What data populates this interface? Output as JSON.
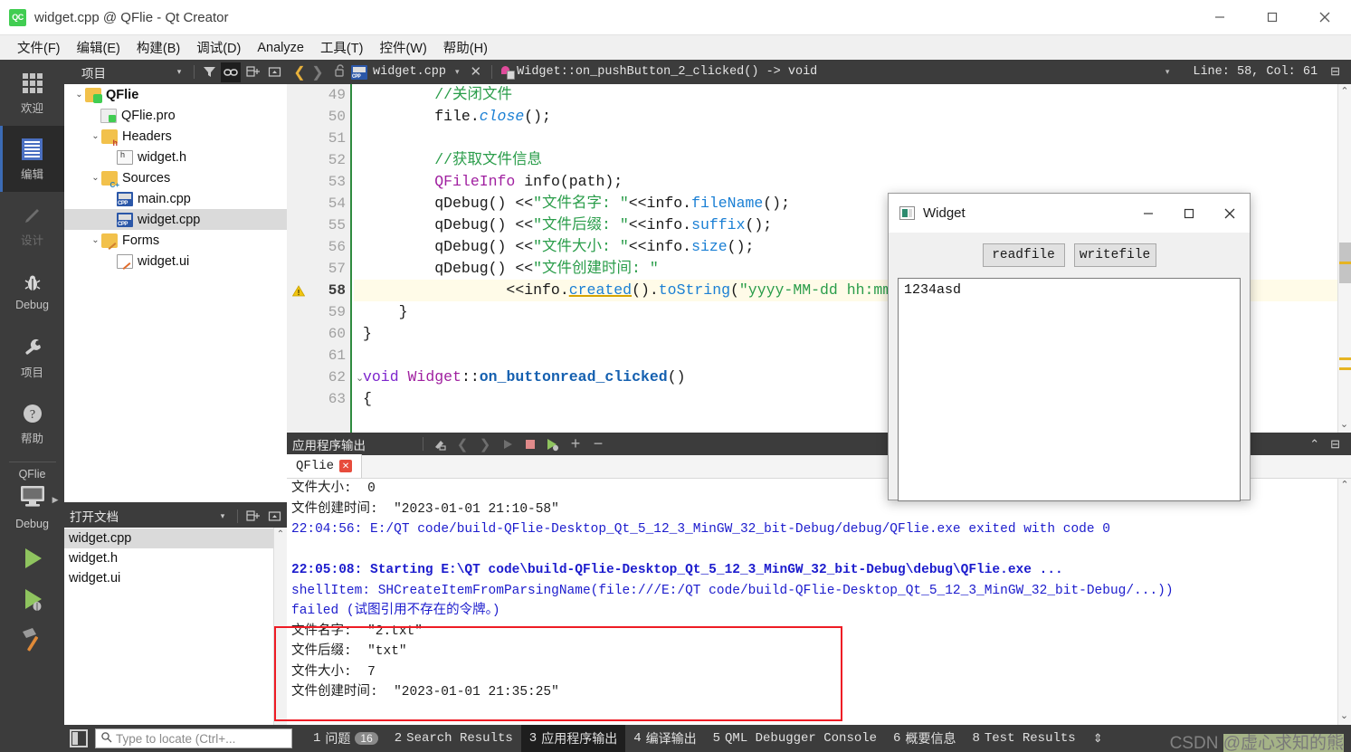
{
  "window": {
    "title": "widget.cpp @ QFlie - Qt Creator",
    "logo_text": "QC",
    "minimize": "—",
    "maximize": "□",
    "close": "✕"
  },
  "menubar": {
    "items": [
      {
        "label": "文件(F)"
      },
      {
        "label": "编辑(E)"
      },
      {
        "label": "构建(B)"
      },
      {
        "label": "调试(D)"
      },
      {
        "label": "Analyze"
      },
      {
        "label": "工具(T)"
      },
      {
        "label": "控件(W)"
      },
      {
        "label": "帮助(H)"
      }
    ]
  },
  "modebar": {
    "items": [
      {
        "label": "欢迎",
        "icon": "grid-icon",
        "active": false
      },
      {
        "label": "编辑",
        "icon": "document-lines-icon",
        "active": true
      },
      {
        "label": "设计",
        "icon": "pencil-icon",
        "active": false
      },
      {
        "label": "Debug",
        "icon": "bug-icon",
        "active": false
      },
      {
        "label": "项目",
        "icon": "wrench-icon",
        "active": false
      },
      {
        "label": "帮助",
        "icon": "question-circle-icon",
        "active": false
      }
    ],
    "kit_project": "QFlie",
    "kit_config": "Debug",
    "run_label": "run",
    "debug_label": "debug",
    "build_label": "build"
  },
  "project_panel": {
    "title": "项目",
    "tools": [
      "filter-icon",
      "link-icon",
      "expand-all-icon",
      "collapse-icon"
    ],
    "tree": [
      {
        "label": "QFlie",
        "indent": 0,
        "chevron": "⌄",
        "icon": "qt-project-folder-icon",
        "bold": true,
        "selected": false
      },
      {
        "label": "QFlie.pro",
        "indent": 1,
        "chevron": "",
        "icon": "pro-file-icon",
        "bold": false,
        "selected": false
      },
      {
        "label": "Headers",
        "indent": 1,
        "chevron": "⌄",
        "icon": "headers-folder-icon",
        "bold": false,
        "selected": false
      },
      {
        "label": "widget.h",
        "indent": 2,
        "chevron": "",
        "icon": "header-file-icon",
        "bold": false,
        "selected": false
      },
      {
        "label": "Sources",
        "indent": 1,
        "chevron": "⌄",
        "icon": "sources-folder-icon",
        "bold": false,
        "selected": false
      },
      {
        "label": "main.cpp",
        "indent": 2,
        "chevron": "",
        "icon": "cpp-file-icon",
        "bold": false,
        "selected": false
      },
      {
        "label": "widget.cpp",
        "indent": 2,
        "chevron": "",
        "icon": "cpp-file-icon",
        "bold": false,
        "selected": true
      },
      {
        "label": "Forms",
        "indent": 1,
        "chevron": "⌄",
        "icon": "forms-folder-icon",
        "bold": false,
        "selected": false
      },
      {
        "label": "widget.ui",
        "indent": 2,
        "chevron": "",
        "icon": "ui-file-icon",
        "bold": false,
        "selected": false
      }
    ]
  },
  "open_documents": {
    "title": "打开文档",
    "items": [
      {
        "label": "widget.cpp",
        "selected": true
      },
      {
        "label": "widget.h",
        "selected": false
      },
      {
        "label": "widget.ui",
        "selected": false
      }
    ]
  },
  "editor_toolbar": {
    "back": "❮",
    "forward": "❯",
    "lock": "🔓",
    "file_name": "widget.cpp",
    "caret": "▾",
    "close": "✕",
    "symbol": "Widget::on_pushButton_2_clicked() -> void",
    "symbol_caret": "▾",
    "line_col": "Line: 58, Col: 61",
    "split": "⊟"
  },
  "code": {
    "lines": [
      {
        "num": "49",
        "warn": false,
        "fold": "",
        "current": false,
        "html": "        <span class=\"cmt\">//关闭文件</span>"
      },
      {
        "num": "50",
        "warn": false,
        "fold": "",
        "current": false,
        "html": "        file.<span class=\"ital\">close</span>();"
      },
      {
        "num": "51",
        "warn": false,
        "fold": "",
        "current": false,
        "html": ""
      },
      {
        "num": "52",
        "warn": false,
        "fold": "",
        "current": false,
        "html": "        <span class=\"cmt\">//获取文件信息</span>"
      },
      {
        "num": "53",
        "warn": false,
        "fold": "",
        "current": false,
        "html": "        <span class=\"typ\">QFileInfo</span> info(path);"
      },
      {
        "num": "54",
        "warn": false,
        "fold": "",
        "current": false,
        "html": "        qDebug() &lt;&lt;<span class=\"str\">\"文件名字: \"</span>&lt;&lt;info.<span class=\"fn\">fileName</span>();"
      },
      {
        "num": "55",
        "warn": false,
        "fold": "",
        "current": false,
        "html": "        qDebug() &lt;&lt;<span class=\"str\">\"文件后缀: \"</span>&lt;&lt;info.<span class=\"fn\">suffix</span>();"
      },
      {
        "num": "56",
        "warn": false,
        "fold": "",
        "current": false,
        "html": "        qDebug() &lt;&lt;<span class=\"str\">\"文件大小: \"</span>&lt;&lt;info.<span class=\"fn\">size</span>();"
      },
      {
        "num": "57",
        "warn": false,
        "fold": "",
        "current": false,
        "html": "        qDebug() &lt;&lt;<span class=\"str\">\"文件创建时间: \"</span>"
      },
      {
        "num": "58",
        "warn": true,
        "fold": "",
        "current": true,
        "html": "                &lt;&lt;info.<span class=\"und\">created</span>().<span class=\"fn\">toString</span>(<span class=\"str\">\"yyyy-MM-dd hh:mm:ss\"</span>);"
      },
      {
        "num": "59",
        "warn": false,
        "fold": "",
        "current": false,
        "html": "    }"
      },
      {
        "num": "60",
        "warn": false,
        "fold": "",
        "current": false,
        "html": "}"
      },
      {
        "num": "61",
        "warn": false,
        "fold": "",
        "current": false,
        "html": ""
      },
      {
        "num": "62",
        "warn": false,
        "fold": "⌄",
        "current": false,
        "html": "<span class=\"kw\">void</span> <span class=\"typ\">Widget</span>::<span class=\"fnb\">on_buttonread_clicked</span>()"
      },
      {
        "num": "63",
        "warn": false,
        "fold": "",
        "current": false,
        "html": "{"
      }
    ]
  },
  "output_panel": {
    "title": "应用程序输出",
    "tools": [
      "clear-icon",
      "prev-icon",
      "next-icon",
      "run-icon",
      "stop-icon",
      "rerun-debug-icon",
      "zoom-in-icon",
      "zoom-out-icon"
    ],
    "collapse": "⌃",
    "maximize": "⊟",
    "tab_label": "QFlie",
    "tab_close": "✕",
    "lines": [
      {
        "text": "文件大小:  0",
        "style": "dark"
      },
      {
        "text": "文件创建时间:  \"2023-01-01 21:10-58\"",
        "style": "dark"
      },
      {
        "text": "22:04:56: E:/QT code/build-QFlie-Desktop_Qt_5_12_3_MinGW_32_bit-Debug/debug/QFlie.exe exited with code 0",
        "style": "blue"
      },
      {
        "text": "",
        "style": "dark"
      },
      {
        "text": "22:05:08: Starting E:\\QT code\\build-QFlie-Desktop_Qt_5_12_3_MinGW_32_bit-Debug\\debug\\QFlie.exe ...",
        "style": "blueb"
      },
      {
        "text": "shellItem: SHCreateItemFromParsingName(file:///E:/QT code/build-QFlie-Desktop_Qt_5_12_3_MinGW_32_bit-Debug/...))",
        "style": "blue"
      },
      {
        "text": "failed (试图引用不存在的令牌。)",
        "style": "blue"
      },
      {
        "text": "文件名字:  \"2.txt\"",
        "style": "dark"
      },
      {
        "text": "文件后缀:  \"txt\"",
        "style": "dark"
      },
      {
        "text": "文件大小:  7",
        "style": "dark"
      },
      {
        "text": "文件创建时间:  \"2023-01-01 21:35:25\"",
        "style": "dark"
      }
    ],
    "highlight_color": "#ee1c25"
  },
  "statusbar": {
    "toggle_sidebar": "sidebar-toggle-icon",
    "locator_placeholder": "Type to locate (Ctrl+...",
    "items": [
      {
        "num": "1",
        "label": "问题",
        "badge": "16",
        "active": false
      },
      {
        "num": "2",
        "label": "Search Results",
        "badge": "",
        "active": false
      },
      {
        "num": "3",
        "label": "应用程序输出",
        "badge": "",
        "active": true
      },
      {
        "num": "4",
        "label": "编译输出",
        "badge": "",
        "active": false
      },
      {
        "num": "5",
        "label": "QML Debugger Console",
        "badge": "",
        "active": false
      },
      {
        "num": "6",
        "label": "概要信息",
        "badge": "",
        "active": false
      },
      {
        "num": "8",
        "label": "Test Results",
        "badge": "",
        "active": false
      }
    ],
    "updown": "⇕"
  },
  "watermark": {
    "prefix": "CSDN ",
    "handle": "@虚心求知的熊"
  },
  "widget_dialog": {
    "title": "Widget",
    "minimize": "—",
    "maximize": "□",
    "close": "✕",
    "buttons": [
      {
        "label": "readfile"
      },
      {
        "label": "writefile"
      }
    ],
    "textarea_value": "1234asd"
  }
}
